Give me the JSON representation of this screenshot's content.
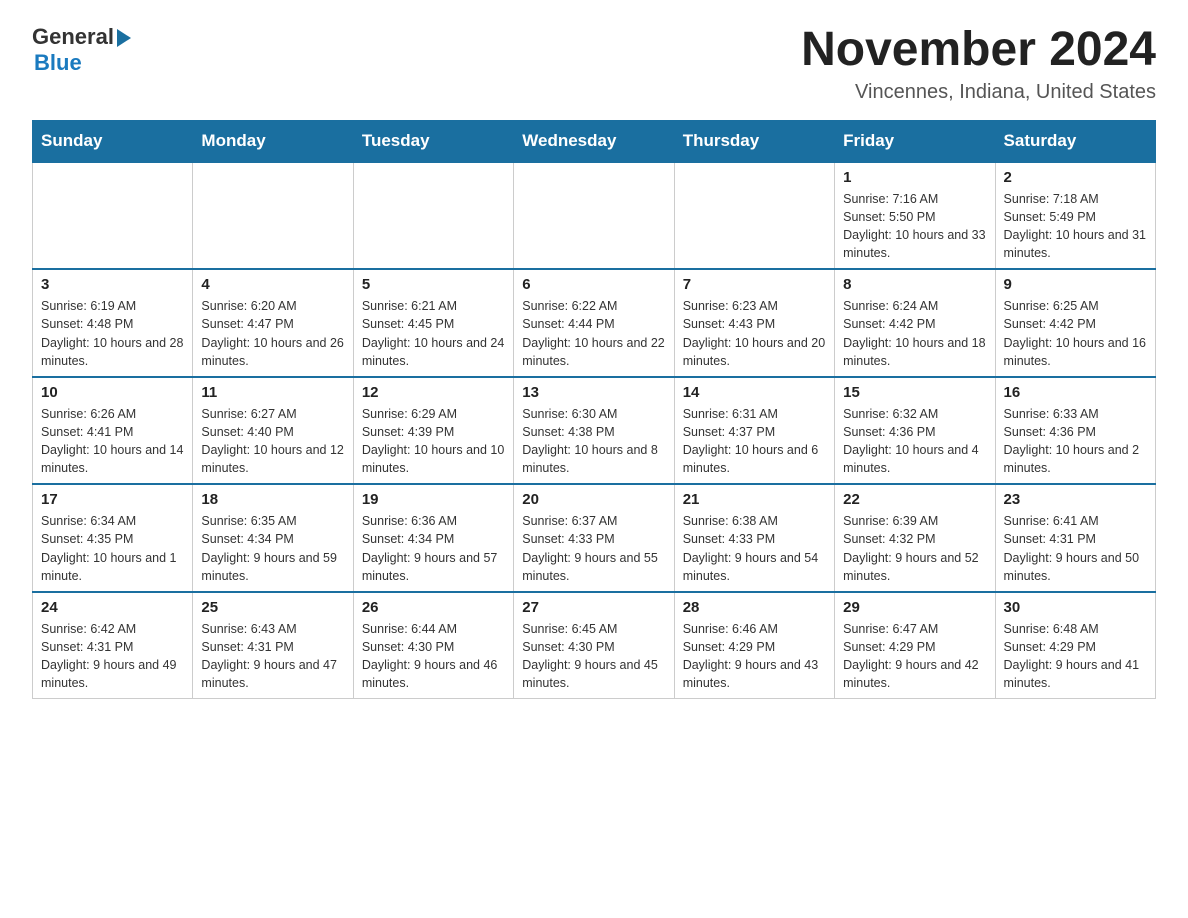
{
  "header": {
    "logo_general": "General",
    "logo_blue": "Blue",
    "month_title": "November 2024",
    "location": "Vincennes, Indiana, United States"
  },
  "weekdays": [
    "Sunday",
    "Monday",
    "Tuesday",
    "Wednesday",
    "Thursday",
    "Friday",
    "Saturday"
  ],
  "weeks": [
    [
      {
        "day": "",
        "info": ""
      },
      {
        "day": "",
        "info": ""
      },
      {
        "day": "",
        "info": ""
      },
      {
        "day": "",
        "info": ""
      },
      {
        "day": "",
        "info": ""
      },
      {
        "day": "1",
        "info": "Sunrise: 7:16 AM\nSunset: 5:50 PM\nDaylight: 10 hours and 33 minutes."
      },
      {
        "day": "2",
        "info": "Sunrise: 7:18 AM\nSunset: 5:49 PM\nDaylight: 10 hours and 31 minutes."
      }
    ],
    [
      {
        "day": "3",
        "info": "Sunrise: 6:19 AM\nSunset: 4:48 PM\nDaylight: 10 hours and 28 minutes."
      },
      {
        "day": "4",
        "info": "Sunrise: 6:20 AM\nSunset: 4:47 PM\nDaylight: 10 hours and 26 minutes."
      },
      {
        "day": "5",
        "info": "Sunrise: 6:21 AM\nSunset: 4:45 PM\nDaylight: 10 hours and 24 minutes."
      },
      {
        "day": "6",
        "info": "Sunrise: 6:22 AM\nSunset: 4:44 PM\nDaylight: 10 hours and 22 minutes."
      },
      {
        "day": "7",
        "info": "Sunrise: 6:23 AM\nSunset: 4:43 PM\nDaylight: 10 hours and 20 minutes."
      },
      {
        "day": "8",
        "info": "Sunrise: 6:24 AM\nSunset: 4:42 PM\nDaylight: 10 hours and 18 minutes."
      },
      {
        "day": "9",
        "info": "Sunrise: 6:25 AM\nSunset: 4:42 PM\nDaylight: 10 hours and 16 minutes."
      }
    ],
    [
      {
        "day": "10",
        "info": "Sunrise: 6:26 AM\nSunset: 4:41 PM\nDaylight: 10 hours and 14 minutes."
      },
      {
        "day": "11",
        "info": "Sunrise: 6:27 AM\nSunset: 4:40 PM\nDaylight: 10 hours and 12 minutes."
      },
      {
        "day": "12",
        "info": "Sunrise: 6:29 AM\nSunset: 4:39 PM\nDaylight: 10 hours and 10 minutes."
      },
      {
        "day": "13",
        "info": "Sunrise: 6:30 AM\nSunset: 4:38 PM\nDaylight: 10 hours and 8 minutes."
      },
      {
        "day": "14",
        "info": "Sunrise: 6:31 AM\nSunset: 4:37 PM\nDaylight: 10 hours and 6 minutes."
      },
      {
        "day": "15",
        "info": "Sunrise: 6:32 AM\nSunset: 4:36 PM\nDaylight: 10 hours and 4 minutes."
      },
      {
        "day": "16",
        "info": "Sunrise: 6:33 AM\nSunset: 4:36 PM\nDaylight: 10 hours and 2 minutes."
      }
    ],
    [
      {
        "day": "17",
        "info": "Sunrise: 6:34 AM\nSunset: 4:35 PM\nDaylight: 10 hours and 1 minute."
      },
      {
        "day": "18",
        "info": "Sunrise: 6:35 AM\nSunset: 4:34 PM\nDaylight: 9 hours and 59 minutes."
      },
      {
        "day": "19",
        "info": "Sunrise: 6:36 AM\nSunset: 4:34 PM\nDaylight: 9 hours and 57 minutes."
      },
      {
        "day": "20",
        "info": "Sunrise: 6:37 AM\nSunset: 4:33 PM\nDaylight: 9 hours and 55 minutes."
      },
      {
        "day": "21",
        "info": "Sunrise: 6:38 AM\nSunset: 4:33 PM\nDaylight: 9 hours and 54 minutes."
      },
      {
        "day": "22",
        "info": "Sunrise: 6:39 AM\nSunset: 4:32 PM\nDaylight: 9 hours and 52 minutes."
      },
      {
        "day": "23",
        "info": "Sunrise: 6:41 AM\nSunset: 4:31 PM\nDaylight: 9 hours and 50 minutes."
      }
    ],
    [
      {
        "day": "24",
        "info": "Sunrise: 6:42 AM\nSunset: 4:31 PM\nDaylight: 9 hours and 49 minutes."
      },
      {
        "day": "25",
        "info": "Sunrise: 6:43 AM\nSunset: 4:31 PM\nDaylight: 9 hours and 47 minutes."
      },
      {
        "day": "26",
        "info": "Sunrise: 6:44 AM\nSunset: 4:30 PM\nDaylight: 9 hours and 46 minutes."
      },
      {
        "day": "27",
        "info": "Sunrise: 6:45 AM\nSunset: 4:30 PM\nDaylight: 9 hours and 45 minutes."
      },
      {
        "day": "28",
        "info": "Sunrise: 6:46 AM\nSunset: 4:29 PM\nDaylight: 9 hours and 43 minutes."
      },
      {
        "day": "29",
        "info": "Sunrise: 6:47 AM\nSunset: 4:29 PM\nDaylight: 9 hours and 42 minutes."
      },
      {
        "day": "30",
        "info": "Sunrise: 6:48 AM\nSunset: 4:29 PM\nDaylight: 9 hours and 41 minutes."
      }
    ]
  ]
}
